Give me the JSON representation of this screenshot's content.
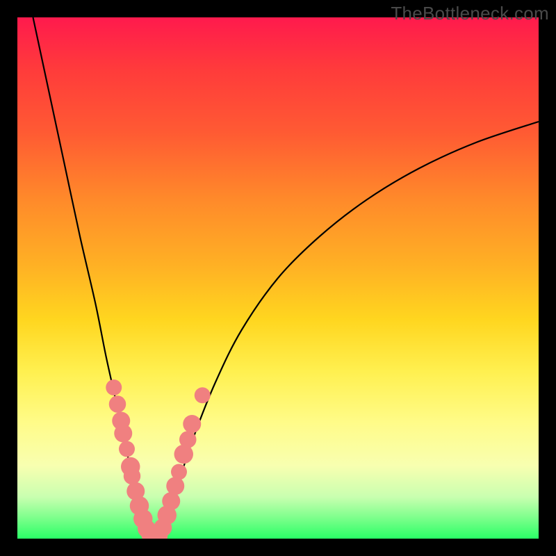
{
  "watermark": "TheBottleneck.com",
  "colors": {
    "frame": "#000000",
    "curve": "#000000",
    "marker": "#f08080",
    "gradient_top": "#ff1a4d",
    "gradient_bottom": "#2aff66"
  },
  "chart_data": {
    "type": "line",
    "title": "",
    "xlabel": "",
    "ylabel": "",
    "xlim": [
      0,
      100
    ],
    "ylim": [
      0,
      100
    ],
    "notes": "Two black V-shaped curves on a rainbow vertical gradient. The apex of the V lies near x≈24–28 at y≈0. Salmon markers cluster along the lower segments of both curve arms.",
    "series": [
      {
        "name": "left-arm",
        "x": [
          3,
          6,
          9,
          12,
          15,
          17,
          19,
          20.5,
          22,
          23,
          24,
          25,
          25.5
        ],
        "y": [
          100,
          86,
          72,
          58,
          45,
          35,
          26,
          19,
          12,
          7,
          3.5,
          1.2,
          0.3
        ]
      },
      {
        "name": "right-arm",
        "x": [
          27,
          28,
          29.5,
          31,
          34,
          38,
          43,
          50,
          58,
          67,
          77,
          88,
          100
        ],
        "y": [
          0.5,
          2.5,
          6,
          11,
          20,
          30,
          40,
          50,
          58,
          65,
          71,
          76,
          80
        ]
      }
    ],
    "markers": [
      {
        "x": 18.5,
        "y": 29,
        "r": 1.0
      },
      {
        "x": 19.2,
        "y": 25.8,
        "r": 1.1
      },
      {
        "x": 19.9,
        "y": 22.6,
        "r": 1.2
      },
      {
        "x": 20.3,
        "y": 20.2,
        "r": 1.2
      },
      {
        "x": 21.0,
        "y": 17.2,
        "r": 1.0
      },
      {
        "x": 21.7,
        "y": 13.8,
        "r": 1.3
      },
      {
        "x": 22.0,
        "y": 12.0,
        "r": 1.1
      },
      {
        "x": 22.7,
        "y": 9.1,
        "r": 1.2
      },
      {
        "x": 23.4,
        "y": 6.3,
        "r": 1.3
      },
      {
        "x": 24.1,
        "y": 3.8,
        "r": 1.3
      },
      {
        "x": 24.8,
        "y": 1.9,
        "r": 1.2
      },
      {
        "x": 25.5,
        "y": 0.8,
        "r": 1.2
      },
      {
        "x": 26.3,
        "y": 0.3,
        "r": 1.2
      },
      {
        "x": 27.1,
        "y": 0.6,
        "r": 1.2
      },
      {
        "x": 27.9,
        "y": 2.1,
        "r": 1.2
      },
      {
        "x": 28.7,
        "y": 4.5,
        "r": 1.3
      },
      {
        "x": 29.5,
        "y": 7.2,
        "r": 1.2
      },
      {
        "x": 30.3,
        "y": 10.1,
        "r": 1.2
      },
      {
        "x": 31.0,
        "y": 12.8,
        "r": 1.0
      },
      {
        "x": 31.9,
        "y": 16.2,
        "r": 1.3
      },
      {
        "x": 32.7,
        "y": 19.0,
        "r": 1.1
      },
      {
        "x": 33.5,
        "y": 22.0,
        "r": 1.2
      },
      {
        "x": 35.5,
        "y": 27.5,
        "r": 1.0
      }
    ]
  }
}
